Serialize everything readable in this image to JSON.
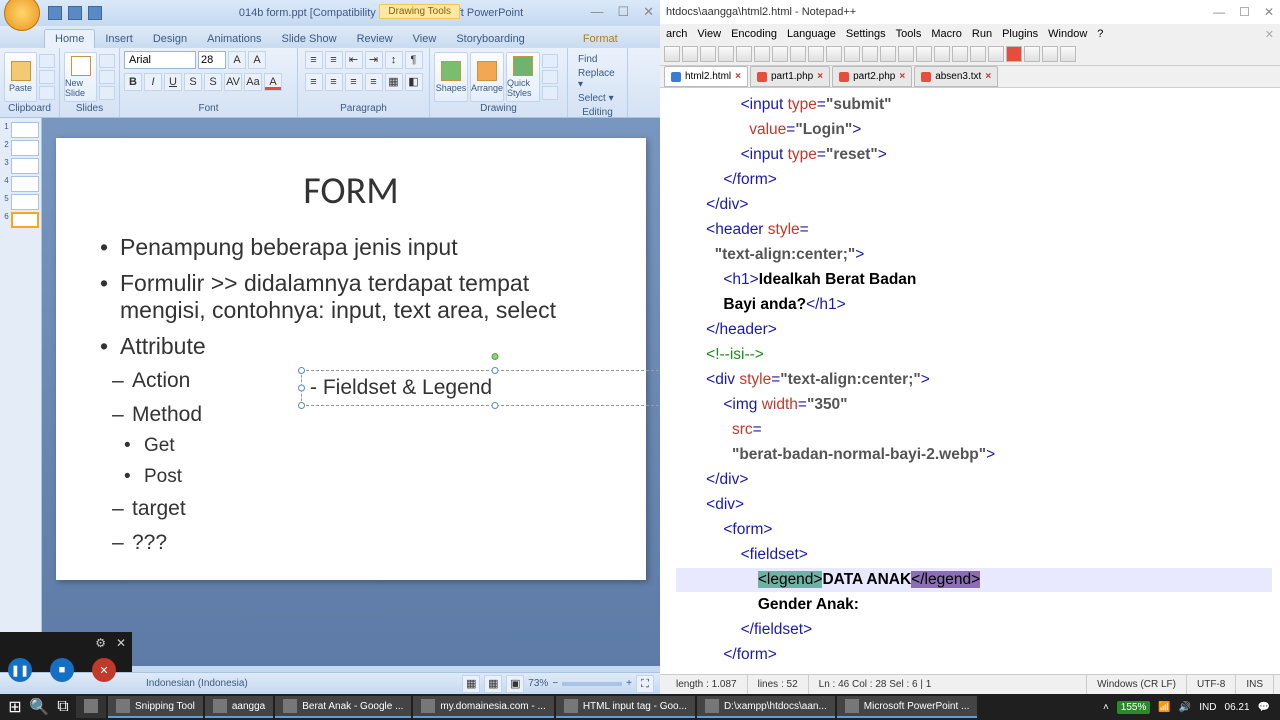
{
  "powerpoint": {
    "title": "014b form.ppt [Compatibility Mode] - Microsoft PowerPoint",
    "drawing_tools": "Drawing Tools",
    "tabs": [
      "Home",
      "Insert",
      "Design",
      "Animations",
      "Slide Show",
      "Review",
      "View",
      "Storyboarding"
    ],
    "tab_format": "Format",
    "ribbon": {
      "clipboard": {
        "label": "Clipboard",
        "paste": "Paste"
      },
      "slides": {
        "label": "Slides",
        "new": "New\nSlide"
      },
      "font": {
        "label": "Font",
        "name": "Arial",
        "size": "28"
      },
      "paragraph": {
        "label": "Paragraph"
      },
      "drawing": {
        "label": "Drawing",
        "shapes": "Shapes",
        "arrange": "Arrange",
        "quick": "Quick\nStyles"
      },
      "editing": {
        "label": "Editing",
        "find": "Find",
        "replace": "Replace ▾",
        "select": "Select ▾"
      }
    },
    "slide": {
      "title": "FORM",
      "b1": "Penampung beberapa jenis input",
      "b2": "Formulir >> didalamnya terdapat tempat mengisi, contohnya: input, text area, select",
      "b3": "Attribute",
      "b3a": "Action",
      "b3b": "Method",
      "b3b1": "Get",
      "b3b2": "Post",
      "b3c": "target",
      "b3d": "???",
      "textbox": "- Fieldset & Legend"
    },
    "status": {
      "lang": "Indonesian (Indonesia)",
      "zoom": "73%"
    }
  },
  "npp": {
    "title": "htdocs\\aangga\\html2.html - Notepad++",
    "menus": [
      "arch",
      "View",
      "Encoding",
      "Language",
      "Settings",
      "Tools",
      "Macro",
      "Run",
      "Plugins",
      "Window",
      "?"
    ],
    "tabs": [
      {
        "name": "html2.html",
        "active": true
      },
      {
        "name": "part1.php",
        "active": false
      },
      {
        "name": "part2.php",
        "active": false
      },
      {
        "name": "absen3.txt",
        "active": false
      }
    ],
    "code": {
      "l1a": "<input ",
      "l1b": "type",
      "l1c": "=",
      "l1d": "\"submit\"",
      "l2a": "value",
      "l2b": "=",
      "l2c": "\"Login\"",
      "l2d": ">",
      "l3a": "<input ",
      "l3b": "type",
      "l3c": "=",
      "l3d": "\"reset\"",
      "l3e": ">",
      "l4": "</form>",
      "l5": "</div>",
      "l6a": "<header ",
      "l6b": "style",
      "l6c": "=",
      "l7a": "\"text-align:center;\"",
      "l7b": ">",
      "l8a": "<h1>",
      "l8b": "Idealkah Berat Badan",
      "l9a": "Bayi anda?",
      "l9b": "</h1>",
      "l10": "</header>",
      "l11": "<!--isi-->",
      "l12a": "<div ",
      "l12b": "style",
      "l12c": "=",
      "l12d": "\"text-align:center;\"",
      "l12e": ">",
      "l13a": "<img ",
      "l13b": "width",
      "l13c": "=",
      "l13d": "\"350\"",
      "l14a": "src",
      "l14b": "=",
      "l15a": "\"berat-badan-normal-bayi-2.webp\"",
      "l15b": ">",
      "l16": "</div>",
      "l17": "<div>",
      "l18": "<form>",
      "l19": "<fieldset>",
      "l20a": "<legend>",
      "l20b": "DATA ANAK",
      "l20c": "</legend>",
      "l21": "Gender Anak:",
      "l22": "</fieldset>",
      "l23": "</form>"
    },
    "status": {
      "length": "length : 1.087",
      "lines": "lines : 52",
      "pos": "Ln : 46    Col : 28    Sel : 6 | 1",
      "eol": "Windows (CR LF)",
      "enc": "UTF-8",
      "mode": "INS"
    }
  },
  "taskbar": {
    "items": [
      "Snipping Tool",
      "aangga",
      "Berat Anak - Google ...",
      "my.domainesia.com - ...",
      "HTML input tag - Goo...",
      "D:\\xampp\\htdocs\\aan...",
      "Microsoft PowerPoint ..."
    ],
    "time": "06.21",
    "lang": "IND",
    "sys": "155%"
  }
}
